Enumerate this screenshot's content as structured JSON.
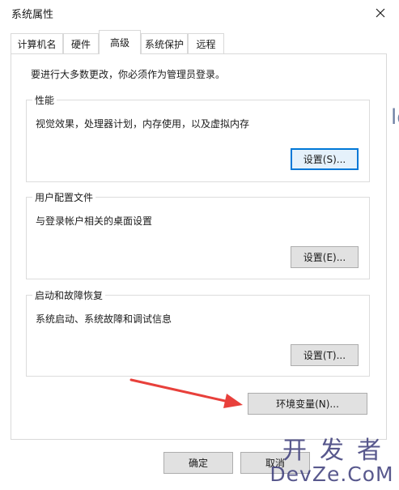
{
  "window": {
    "title": "系统属性"
  },
  "tabs": [
    {
      "label": "计算机名"
    },
    {
      "label": "硬件"
    },
    {
      "label": "高级"
    },
    {
      "label": "系统保护"
    },
    {
      "label": "远程"
    }
  ],
  "active_tab": "高级",
  "advanced": {
    "admin_note": "要进行大多数更改，你必须作为管理员登录。",
    "performance": {
      "title": "性能",
      "description": "视觉效果，处理器计划，内存使用，以及虚拟内存",
      "settings_label": "设置(S)..."
    },
    "user_profiles": {
      "title": "用户配置文件",
      "description": "与登录帐户相关的桌面设置",
      "settings_label": "设置(E)..."
    },
    "startup_recovery": {
      "title": "启动和故障恢复",
      "description": "系统启动、系统故障和调试信息",
      "settings_label": "设置(T)..."
    },
    "env_vars_label": "环境变量(N)..."
  },
  "footer": {
    "ok_label": "确定",
    "cancel_label": "取消"
  },
  "watermark": {
    "top": "开发者",
    "bottom": "DevZe.CoM"
  },
  "colors": {
    "accent": "#0078d7",
    "annotation_arrow": "#e8403b"
  }
}
